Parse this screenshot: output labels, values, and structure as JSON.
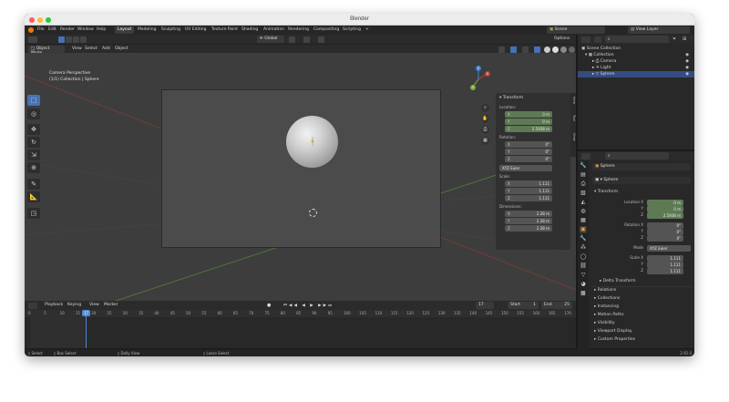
{
  "window": {
    "title": "Blender"
  },
  "menubar": {
    "items": [
      "File",
      "Edit",
      "Render",
      "Window",
      "Help"
    ],
    "workspaces": [
      "Layout",
      "Modeling",
      "Sculpting",
      "UV Editing",
      "Texture Paint",
      "Shading",
      "Animation",
      "Rendering",
      "Compositing",
      "Scripting"
    ],
    "add_tab": "+",
    "scene": "Scene",
    "view_layer": "View Layer"
  },
  "viewport_header": {
    "mode": "Object Mode",
    "menus": [
      "View",
      "Select",
      "Add",
      "Object"
    ],
    "transform_orientation": "Global",
    "options": "Options"
  },
  "viewport": {
    "perspective_label": "Camera Perspective",
    "collection_label": "(1/1) Collection | Sphere"
  },
  "tools": [
    "select",
    "cursor",
    "move",
    "rotate",
    "scale",
    "transform",
    "annotate",
    "measure",
    "add-cube"
  ],
  "npanel": {
    "section": "Transform",
    "location_label": "Location:",
    "location": [
      {
        "axis": "X",
        "value": "0 m"
      },
      {
        "axis": "Y",
        "value": "0 m"
      },
      {
        "axis": "Z",
        "value": "2.5938 m"
      }
    ],
    "rotation_label": "Rotation:",
    "rotation": [
      {
        "axis": "X",
        "value": "0°"
      },
      {
        "axis": "Y",
        "value": "0°"
      },
      {
        "axis": "Z",
        "value": "0°"
      }
    ],
    "rotation_mode": "XYZ Euler",
    "scale_label": "Scale:",
    "scale": [
      {
        "axis": "X",
        "value": "1.111"
      },
      {
        "axis": "Y",
        "value": "1.111"
      },
      {
        "axis": "Z",
        "value": "1.111"
      }
    ],
    "dimensions_label": "Dimensions:",
    "dimensions": [
      {
        "axis": "X",
        "value": "2.28 m"
      },
      {
        "axis": "Y",
        "value": "2.28 m"
      },
      {
        "axis": "Z",
        "value": "2.28 m"
      }
    ],
    "tabs": [
      "Item",
      "Tool",
      "View"
    ]
  },
  "timeline_header": {
    "menus": [
      "Playback",
      "Keying",
      "View",
      "Marker"
    ],
    "current_frame": "17",
    "start_label": "Start",
    "start": "1",
    "end_label": "End",
    "end": "25"
  },
  "timeline": {
    "ticks": [
      "0",
      "5",
      "10",
      "15",
      "20",
      "25",
      "30",
      "35",
      "40",
      "45",
      "50",
      "55",
      "60",
      "65",
      "70",
      "75",
      "80",
      "85",
      "90",
      "95",
      "100",
      "105",
      "110",
      "115",
      "120",
      "125",
      "130",
      "135",
      "140",
      "145",
      "150",
      "155",
      "160",
      "165",
      "170"
    ],
    "playhead_label": "17"
  },
  "statusbar": {
    "items": [
      "Select",
      "Box Select",
      "Dolly View",
      "Lasso Select"
    ],
    "version": "2.92.0"
  },
  "outliner": {
    "root": "Scene Collection",
    "collection": "Collection",
    "objects": [
      "Camera",
      "Light",
      "Sphere"
    ]
  },
  "properties": {
    "object_name": "Sphere",
    "data_name": "Sphere",
    "section": "Transform",
    "location_label": "Location X",
    "location": [
      "0 m",
      "0 m",
      "2.5938 m"
    ],
    "rotation_label": "Rotation X",
    "rotation": [
      "0°",
      "0°",
      "0°"
    ],
    "mode_label": "Mode",
    "mode": "XYZ Euler",
    "scale_label": "Scale X",
    "scale": [
      "1.111",
      "1.111",
      "1.111"
    ],
    "axis_labels": [
      "Y",
      "Z"
    ],
    "delta": "Delta Transform",
    "collapsed": [
      "Relations",
      "Collections",
      "Instancing",
      "Motion Paths",
      "Visibility",
      "Viewport Display",
      "Custom Properties"
    ]
  },
  "colors": {
    "accent": "#4772b3",
    "x_axis": "#c2443b",
    "y_axis": "#7bb03a",
    "z_axis": "#3e7fd6",
    "field_green": "#5d7a55"
  }
}
